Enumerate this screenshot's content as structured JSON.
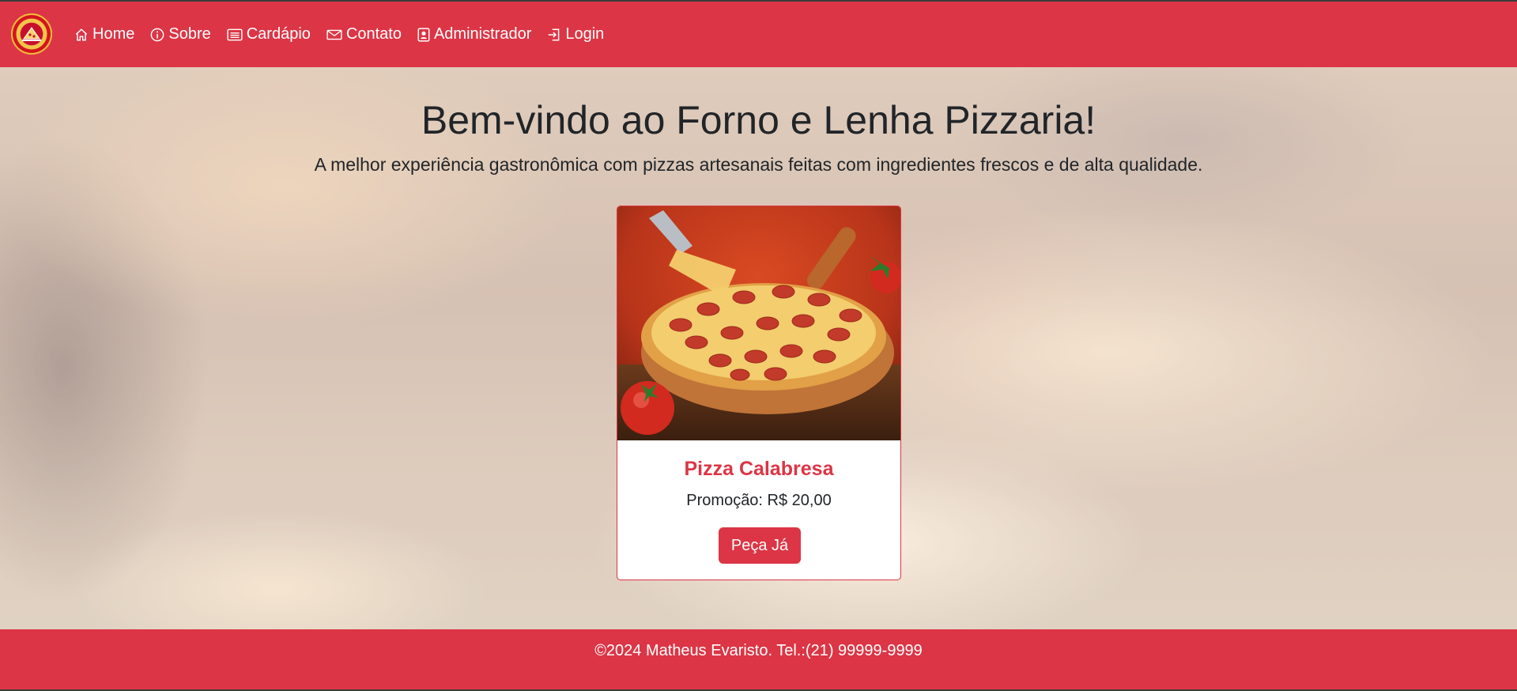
{
  "navbar": {
    "background": "#dc3545",
    "logo_icon": "pizzeria-logo",
    "items": [
      {
        "label": "Home",
        "icon": "house-icon"
      },
      {
        "label": "Sobre",
        "icon": "info-circle-icon"
      },
      {
        "label": "Cardápio",
        "icon": "list-card-icon"
      },
      {
        "label": "Contato",
        "icon": "envelope-icon"
      },
      {
        "label": "Administrador",
        "icon": "person-badge-icon"
      },
      {
        "label": "Login",
        "icon": "box-arrow-in-right-icon"
      }
    ]
  },
  "hero": {
    "title": "Bem-vindo ao Forno e Lenha Pizzaria!",
    "subtitle": "A melhor experiência gastronômica com pizzas artesanais feitas com ingredientes frescos e de alta qualidade."
  },
  "card": {
    "title": "Pizza Calabresa",
    "price": "Promoção: R$ 20,00",
    "button_label": "Peça Já",
    "accent": "#dc3545"
  },
  "footer": {
    "text": "©2024 Matheus Evaristo. Tel.:(21) 99999-9999"
  }
}
